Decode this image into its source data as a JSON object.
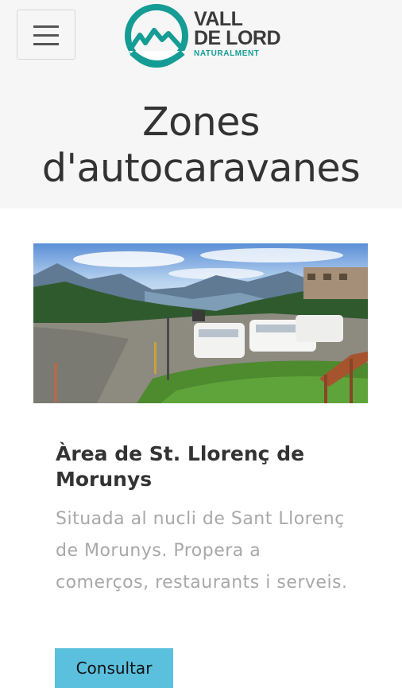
{
  "header": {
    "menu_icon": "hamburger-menu-icon",
    "logo": {
      "line1": "VALL",
      "line2": "DE LORD",
      "tagline": "NATURALMENT",
      "brand_color": "#149c95"
    }
  },
  "page": {
    "title": "Zones d'autocaravanes"
  },
  "card": {
    "image_icon": "photo-campervans-parking",
    "title": "Àrea de St. Llorenç de Morunys",
    "description": "Situada al nucli de Sant Llorenç de Morunys. Propera a comerços, restaurants i serveis.",
    "button_label": "Consultar",
    "button_color": "#5bc0de"
  }
}
